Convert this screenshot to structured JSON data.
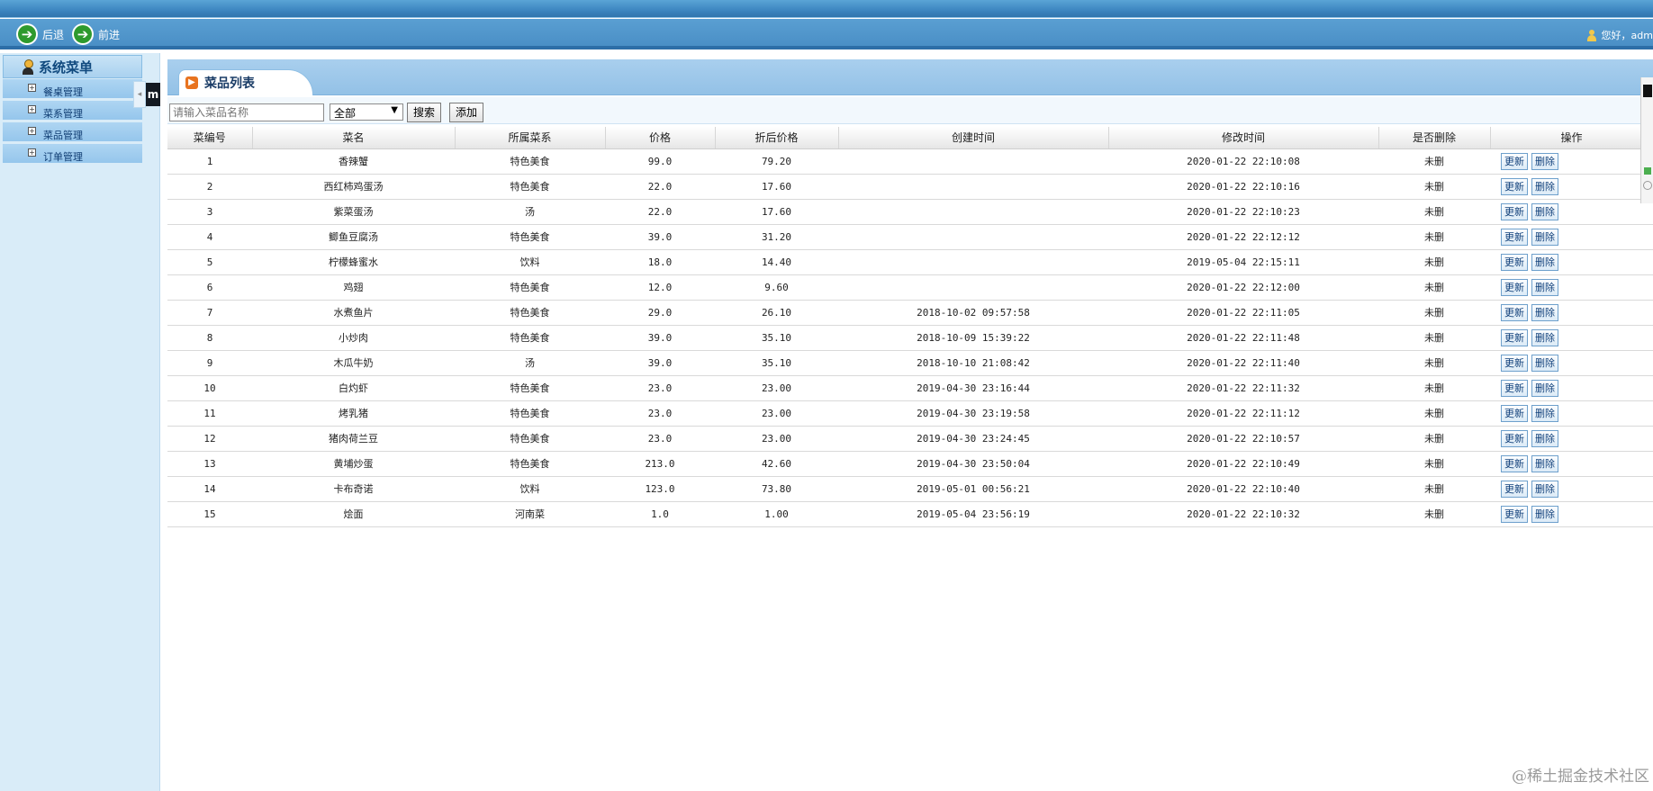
{
  "header": {
    "back_label": "后退",
    "forward_label": "前进",
    "greeting": "您好，adm"
  },
  "sidebar": {
    "title": "系统菜单",
    "items": [
      {
        "label": "餐桌管理"
      },
      {
        "label": "菜系管理"
      },
      {
        "label": "菜品管理"
      },
      {
        "label": "订单管理"
      }
    ],
    "collapse_glyph": "◂",
    "side_tab_text": "m"
  },
  "tab": {
    "label": "菜品列表",
    "icon": "arrow-icon"
  },
  "toolbar": {
    "search_placeholder": "请输入菜品名称",
    "select_value": "全部",
    "search_label": "搜索",
    "add_label": "添加"
  },
  "table": {
    "headers": [
      "菜编号",
      "菜名",
      "所属菜系",
      "价格",
      "折后价格",
      "创建时间",
      "修改时间",
      "是否删除",
      "操作"
    ],
    "update_label": "更新",
    "delete_label": "删除",
    "rows": [
      {
        "id": "1",
        "name": "香辣蟹",
        "cuisine": "特色美食",
        "price": "99.0",
        "discount": "79.20",
        "created": "",
        "modified": "2020-01-22 22:10:08",
        "deleted": "未删"
      },
      {
        "id": "2",
        "name": "西红柿鸡蛋汤",
        "cuisine": "特色美食",
        "price": "22.0",
        "discount": "17.60",
        "created": "",
        "modified": "2020-01-22 22:10:16",
        "deleted": "未删"
      },
      {
        "id": "3",
        "name": "紫菜蛋汤",
        "cuisine": "汤",
        "price": "22.0",
        "discount": "17.60",
        "created": "",
        "modified": "2020-01-22 22:10:23",
        "deleted": "未删"
      },
      {
        "id": "4",
        "name": "鲫鱼豆腐汤",
        "cuisine": "特色美食",
        "price": "39.0",
        "discount": "31.20",
        "created": "",
        "modified": "2020-01-22 22:12:12",
        "deleted": "未删"
      },
      {
        "id": "5",
        "name": "柠檬蜂蜜水",
        "cuisine": "饮料",
        "price": "18.0",
        "discount": "14.40",
        "created": "",
        "modified": "2019-05-04 22:15:11",
        "deleted": "未删"
      },
      {
        "id": "6",
        "name": "鸡翅",
        "cuisine": "特色美食",
        "price": "12.0",
        "discount": "9.60",
        "created": "",
        "modified": "2020-01-22 22:12:00",
        "deleted": "未删"
      },
      {
        "id": "7",
        "name": "水煮鱼片",
        "cuisine": "特色美食",
        "price": "29.0",
        "discount": "26.10",
        "created": "2018-10-02 09:57:58",
        "modified": "2020-01-22 22:11:05",
        "deleted": "未删"
      },
      {
        "id": "8",
        "name": "小炒肉",
        "cuisine": "特色美食",
        "price": "39.0",
        "discount": "35.10",
        "created": "2018-10-09 15:39:22",
        "modified": "2020-01-22 22:11:48",
        "deleted": "未删"
      },
      {
        "id": "9",
        "name": "木瓜牛奶",
        "cuisine": "汤",
        "price": "39.0",
        "discount": "35.10",
        "created": "2018-10-10 21:08:42",
        "modified": "2020-01-22 22:11:40",
        "deleted": "未删"
      },
      {
        "id": "10",
        "name": "白灼虾",
        "cuisine": "特色美食",
        "price": "23.0",
        "discount": "23.00",
        "created": "2019-04-30 23:16:44",
        "modified": "2020-01-22 22:11:32",
        "deleted": "未删"
      },
      {
        "id": "11",
        "name": "烤乳猪",
        "cuisine": "特色美食",
        "price": "23.0",
        "discount": "23.00",
        "created": "2019-04-30 23:19:58",
        "modified": "2020-01-22 22:11:12",
        "deleted": "未删"
      },
      {
        "id": "12",
        "name": "猪肉荷兰豆",
        "cuisine": "特色美食",
        "price": "23.0",
        "discount": "23.00",
        "created": "2019-04-30 23:24:45",
        "modified": "2020-01-22 22:10:57",
        "deleted": "未删"
      },
      {
        "id": "13",
        "name": "黄埔炒蛋",
        "cuisine": "特色美食",
        "price": "213.0",
        "discount": "42.60",
        "created": "2019-04-30 23:50:04",
        "modified": "2020-01-22 22:10:49",
        "deleted": "未删"
      },
      {
        "id": "14",
        "name": "卡布奇诺",
        "cuisine": "饮料",
        "price": "123.0",
        "discount": "73.80",
        "created": "2019-05-01 00:56:21",
        "modified": "2020-01-22 22:10:40",
        "deleted": "未删"
      },
      {
        "id": "15",
        "name": "烩面",
        "cuisine": "河南菜",
        "price": "1.0",
        "discount": "1.00",
        "created": "2019-05-04 23:56:19",
        "modified": "2020-01-22 22:10:32",
        "deleted": "未删"
      }
    ]
  },
  "watermark": "@稀土掘金技术社区",
  "colors": {
    "nav": "#4a8fc6",
    "sidebar": "#d9ecf8",
    "tab_icon": "#e8731f"
  }
}
